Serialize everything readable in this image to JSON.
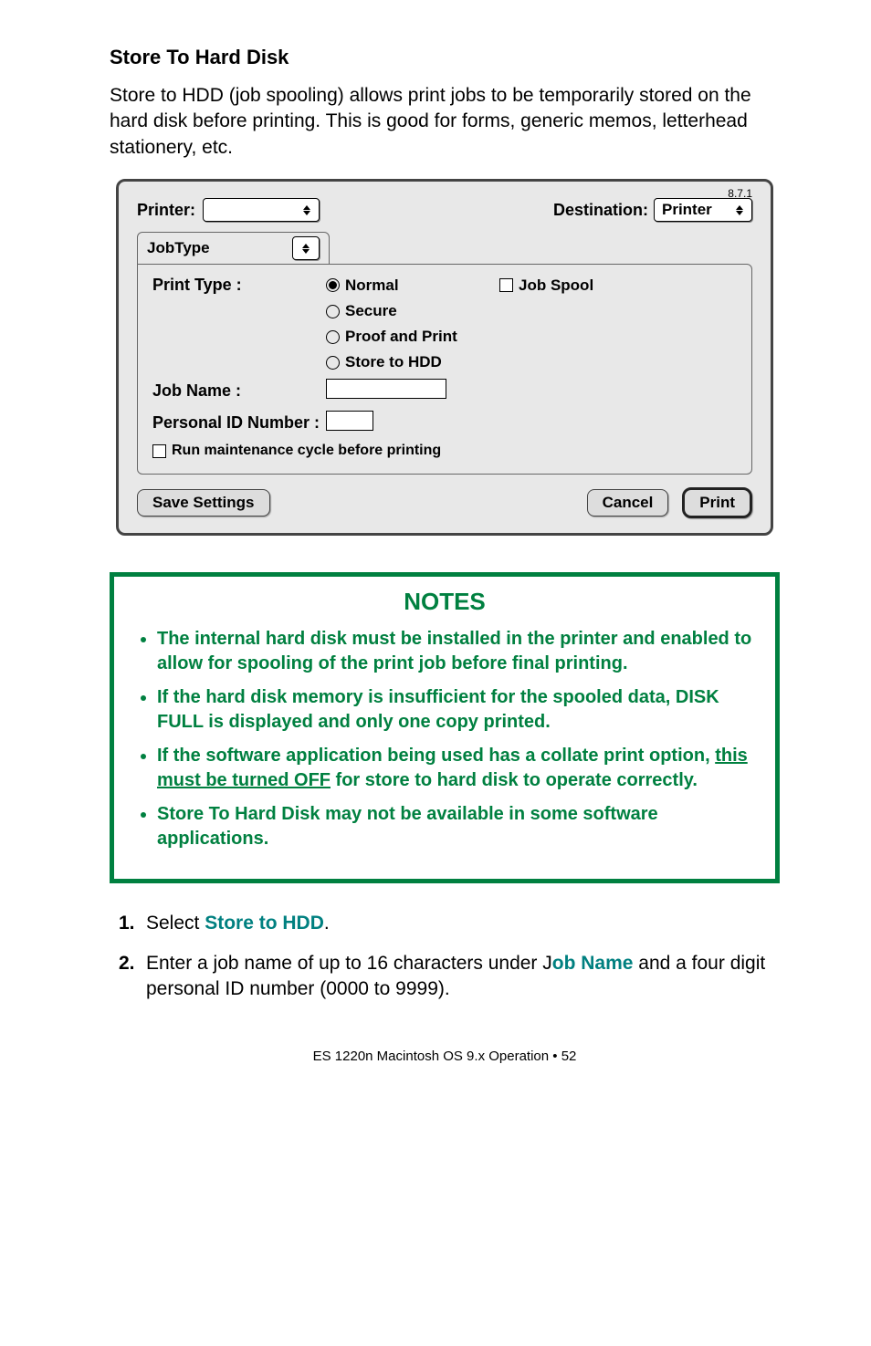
{
  "heading": "Store To Hard Disk",
  "intro": "Store to HDD (job spooling) allows print jobs to be temporarily stored on the hard disk before printing.  This is good for forms, generic memos, letterhead stationery, etc.",
  "dialog": {
    "version": "8.7.1",
    "printer_label": "Printer:",
    "destination_label": "Destination:",
    "destination_value": "Printer",
    "tab": "JobType",
    "print_type_label": "Print Type :",
    "radio_normal": "Normal",
    "radio_secure": "Secure",
    "radio_proof": "Proof and Print",
    "radio_store": "Store to HDD",
    "checkbox_jobspool": "Job Spool",
    "job_name_label": "Job Name :",
    "pin_label": "Personal ID Number :",
    "checkbox_runmaint": "Run maintenance cycle before printing",
    "btn_save": "Save Settings",
    "btn_cancel": "Cancel",
    "btn_print": "Print"
  },
  "notes": {
    "title": "NOTES",
    "items": [
      "The internal hard disk must be installed in the printer and enabled to allow for spooling of the print job before final printing.",
      "If the hard disk memory is insufficient for the spooled data, DISK FULL is displayed and only one copy printed.",
      {
        "pre": "If the software application being used has a collate print option, ",
        "underline": "this must be turned OFF",
        "post": " for store to hard disk to operate correctly."
      },
      "Store To Hard Disk may not be available in some software applications."
    ]
  },
  "steps": {
    "s1_pre": "Select ",
    "s1_em": "Store to HDD",
    "s1_post": ".",
    "s2_pre": "Enter a job name of up to 16 characters under J",
    "s2_em": "ob Name",
    "s2_post": " and a four digit personal ID number (0000 to 9999)."
  },
  "footer": "ES 1220n Macintosh OS 9.x Operation  • 52"
}
